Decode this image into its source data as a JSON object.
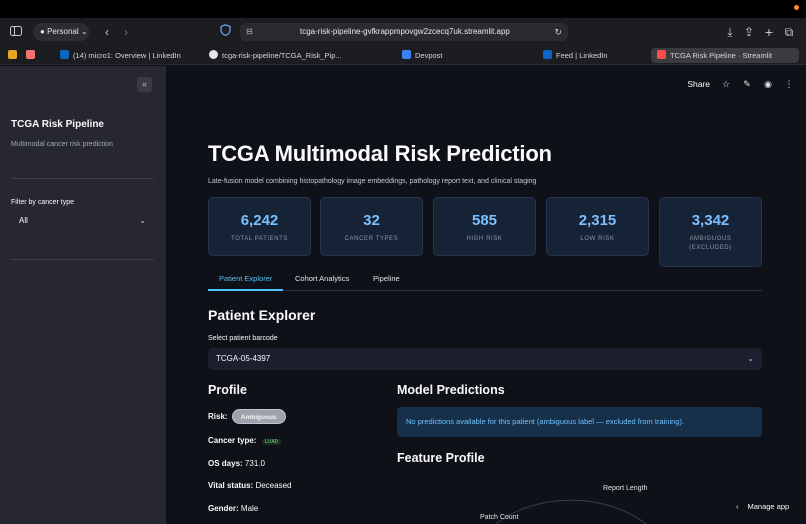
{
  "browser": {
    "profile": "Personal",
    "url": "tcga-risk-pipeline-gvfkrappmpovgw2zcecq7uk.streamlit.app",
    "tabs": [
      {
        "label": "(14) micro1: Overview | LinkedIn",
        "favicon_color": "#0a66c2"
      },
      {
        "label": "tcga-risk-pipeline/TCGA_Risk_Pip...",
        "favicon_color": "#e6e6e6"
      },
      {
        "label": "Devpost",
        "favicon_color": "#3b82f6"
      },
      {
        "label": "Feed | LinkedIn",
        "favicon_color": "#0a66c2"
      },
      {
        "label": "TCGA Risk Pipeline · Streamlit",
        "favicon_color": "#ff4b4b"
      }
    ]
  },
  "sidebar": {
    "title": "TCGA Risk Pipeline",
    "subtitle": "Multimodal cancer risk prediction",
    "filter_label": "Filter by cancer type",
    "filter_value": "All"
  },
  "header": {
    "share_label": "Share"
  },
  "page": {
    "title": "TCGA Multimodal Risk Prediction",
    "subtitle": "Late-fusion model combining histopathology image embeddings, pathology report text, and clinical staging"
  },
  "metrics": [
    {
      "value": "6,242",
      "label": "Total Patients"
    },
    {
      "value": "32",
      "label": "Cancer Types"
    },
    {
      "value": "585",
      "label": "High Risk"
    },
    {
      "value": "2,315",
      "label": "Low Risk"
    },
    {
      "value": "3,342",
      "label": "Ambiguous (Excluded)"
    }
  ],
  "tabs": [
    "Patient Explorer",
    "Cohort Analytics",
    "Pipeline"
  ],
  "explorer": {
    "title": "Patient Explorer",
    "select_label": "Select patient barcode",
    "barcode": "TCGA-05-4397"
  },
  "profile": {
    "title": "Profile",
    "risk_key": "Risk:",
    "risk_value": "Ambiguous",
    "cancer_key": "Cancer type:",
    "cancer_value": "LUAD",
    "os_key": "OS days:",
    "os_value": "731.0",
    "vital_key": "Vital status:",
    "vital_value": "Deceased",
    "gender_key": "Gender:",
    "gender_value": "Male"
  },
  "predictions": {
    "title": "Model Predictions",
    "message": "No predictions available for this patient (ambiguous label — excluded from training)."
  },
  "feature_profile": {
    "title": "Feature Profile",
    "axis_labels": [
      "Report Length",
      "Patch Count"
    ]
  },
  "footer": {
    "manage_app": "Manage app"
  }
}
